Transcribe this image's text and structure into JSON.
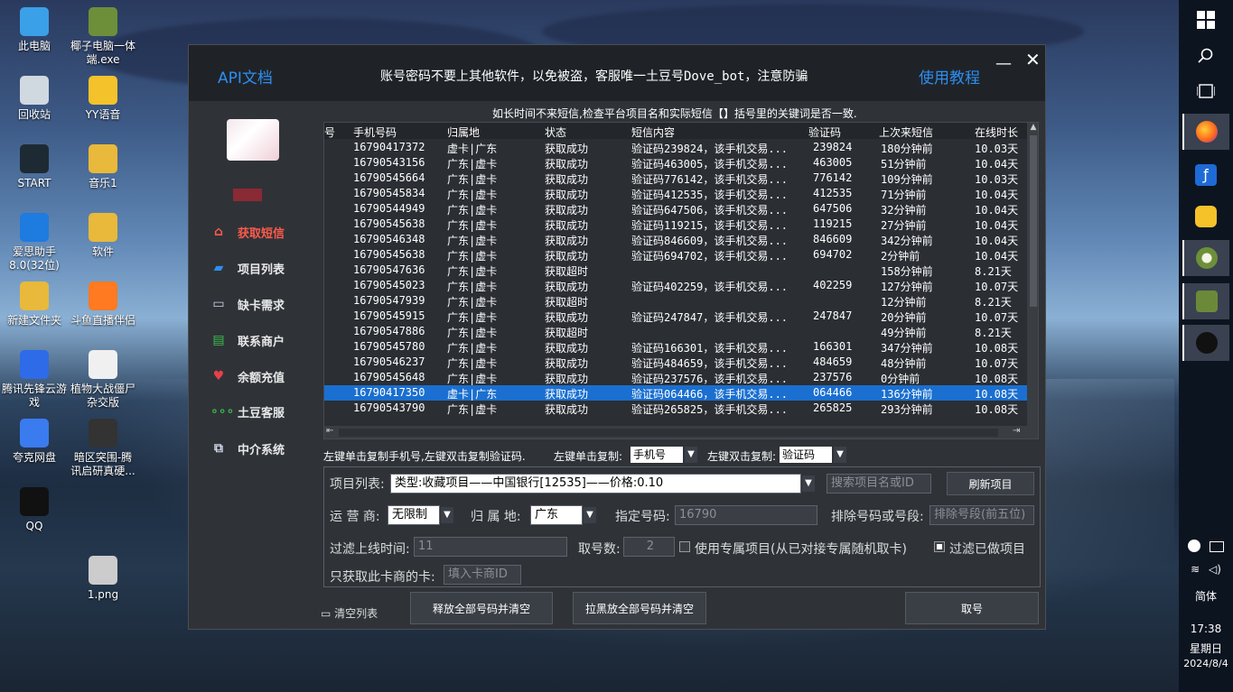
{
  "desktop_icons": [
    {
      "label": "此电脑",
      "icon": "computer-icon",
      "color": "#3aa0e8"
    },
    {
      "label": "椰子电脑一体端.exe",
      "icon": "coconut-icon",
      "color": "#6d8f3a"
    },
    {
      "label": "回收站",
      "icon": "recycle-bin-icon",
      "color": "#d0d8e0"
    },
    {
      "label": "YY语音",
      "icon": "yy-icon",
      "color": "#f4c22b"
    },
    {
      "label": "START",
      "icon": "start-icon",
      "color": "#1e2a33"
    },
    {
      "label": "音乐1",
      "icon": "folder-icon",
      "color": "#e8b93a"
    },
    {
      "label": "爱思助手8.0(32位)",
      "icon": "i4-icon",
      "color": "#1e7be0"
    },
    {
      "label": "软件",
      "icon": "folder-icon",
      "color": "#e8b93a"
    },
    {
      "label": "新建文件夹",
      "icon": "folder-icon",
      "color": "#e8b93a"
    },
    {
      "label": "斗鱼直播伴侣",
      "icon": "douyu-icon",
      "color": "#ff7a20"
    },
    {
      "label": "腾讯先锋云游戏",
      "icon": "cloud-game-icon",
      "color": "#2d6be8"
    },
    {
      "label": "植物大战僵尸杂交版",
      "icon": "file-icon",
      "color": "#f0f0f0"
    },
    {
      "label": "夸克网盘",
      "icon": "quark-icon",
      "color": "#3a7bf0"
    },
    {
      "label": "暗区突围-腾讯启研真硬...",
      "icon": "game-icon",
      "color": "#333333"
    },
    {
      "label": "QQ",
      "icon": "qq-icon",
      "color": "#111111"
    },
    {
      "label": "1.png",
      "icon": "image-icon",
      "color": "#cccccc"
    }
  ],
  "window": {
    "api_doc": "API文档",
    "notice": "账号密码不要上其他软件，以免被盗，客服唯一土豆号Dove_bot，注意防骗",
    "tutorial": "使用教程",
    "minimize": "—",
    "close": "✕"
  },
  "nav": [
    {
      "label": "获取短信",
      "icon": "home-icon",
      "glyph": "⌂",
      "active": true
    },
    {
      "label": "项目列表",
      "icon": "folder-icon",
      "glyph": "▰",
      "active": false
    },
    {
      "label": "缺卡需求",
      "icon": "monitor-icon",
      "glyph": "▭",
      "active": false
    },
    {
      "label": "联系商户",
      "icon": "chat-icon",
      "glyph": "▤",
      "active": false
    },
    {
      "label": "余额充值",
      "icon": "heart-icon",
      "glyph": "♥",
      "active": false
    },
    {
      "label": "土豆客服",
      "icon": "dots-icon",
      "glyph": "∘∘∘",
      "active": false
    },
    {
      "label": "中介系统",
      "icon": "network-icon",
      "glyph": "⧉",
      "active": false
    }
  ],
  "hint_top": "如长时间不来短信,检查平台项目名和实际短信【】括号里的关键词是否一致.",
  "table": {
    "headers": [
      "号",
      "手机号码",
      "归属地",
      "状态",
      "短信内容",
      "验证码",
      "上次来短信",
      "在线时长"
    ],
    "rows": [
      {
        "phone": "16790417372",
        "loc": "虚卡|广东",
        "status": "获取成功",
        "sms": "验证码239824，该手机交易...",
        "code": "239824",
        "last": "180分钟前",
        "online": "10.03天",
        "selected": false
      },
      {
        "phone": "16790543156",
        "loc": "广东|虚卡",
        "status": "获取成功",
        "sms": "验证码463005，该手机交易...",
        "code": "463005",
        "last": "51分钟前",
        "online": "10.04天",
        "selected": false
      },
      {
        "phone": "16790545664",
        "loc": "广东|虚卡",
        "status": "获取成功",
        "sms": "验证码776142，该手机交易...",
        "code": "776142",
        "last": "109分钟前",
        "online": "10.03天",
        "selected": false
      },
      {
        "phone": "16790545834",
        "loc": "广东|虚卡",
        "status": "获取成功",
        "sms": "验证码412535，该手机交易...",
        "code": "412535",
        "last": "71分钟前",
        "online": "10.04天",
        "selected": false
      },
      {
        "phone": "16790544949",
        "loc": "广东|虚卡",
        "status": "获取成功",
        "sms": "验证码647506，该手机交易...",
        "code": "647506",
        "last": "32分钟前",
        "online": "10.04天",
        "selected": false
      },
      {
        "phone": "16790545638",
        "loc": "广东|虚卡",
        "status": "获取成功",
        "sms": "验证码119215，该手机交易...",
        "code": "119215",
        "last": "27分钟前",
        "online": "10.04天",
        "selected": false
      },
      {
        "phone": "16790546348",
        "loc": "广东|虚卡",
        "status": "获取成功",
        "sms": "验证码846609，该手机交易...",
        "code": "846609",
        "last": "342分钟前",
        "online": "10.04天",
        "selected": false
      },
      {
        "phone": "16790545638",
        "loc": "广东|虚卡",
        "status": "获取成功",
        "sms": "验证码694702，该手机交易...",
        "code": "694702",
        "last": "2分钟前",
        "online": "10.04天",
        "selected": false
      },
      {
        "phone": "16790547636",
        "loc": "广东|虚卡",
        "status": "获取超时",
        "sms": "",
        "code": "",
        "last": "158分钟前",
        "online": "8.21天",
        "selected": false
      },
      {
        "phone": "16790545023",
        "loc": "广东|虚卡",
        "status": "获取成功",
        "sms": "验证码402259，该手机交易...",
        "code": "402259",
        "last": "127分钟前",
        "online": "10.07天",
        "selected": false
      },
      {
        "phone": "16790547939",
        "loc": "广东|虚卡",
        "status": "获取超时",
        "sms": "",
        "code": "",
        "last": "12分钟前",
        "online": "8.21天",
        "selected": false
      },
      {
        "phone": "16790545915",
        "loc": "广东|虚卡",
        "status": "获取成功",
        "sms": "验证码247847，该手机交易...",
        "code": "247847",
        "last": "20分钟前",
        "online": "10.07天",
        "selected": false
      },
      {
        "phone": "16790547886",
        "loc": "广东|虚卡",
        "status": "获取超时",
        "sms": "",
        "code": "",
        "last": "49分钟前",
        "online": "8.21天",
        "selected": false
      },
      {
        "phone": "16790545780",
        "loc": "广东|虚卡",
        "status": "获取成功",
        "sms": "验证码166301，该手机交易...",
        "code": "166301",
        "last": "347分钟前",
        "online": "10.08天",
        "selected": false
      },
      {
        "phone": "16790546237",
        "loc": "广东|虚卡",
        "status": "获取成功",
        "sms": "验证码484659，该手机交易...",
        "code": "484659",
        "last": "48分钟前",
        "online": "10.07天",
        "selected": false
      },
      {
        "phone": "16790545648",
        "loc": "广东|虚卡",
        "status": "获取成功",
        "sms": "验证码237576，该手机交易...",
        "code": "237576",
        "last": "0分钟前",
        "online": "10.08天",
        "selected": false
      },
      {
        "phone": "16790417350",
        "loc": "虚卡|广东",
        "status": "获取成功",
        "sms": "验证码064466，该手机交易...",
        "code": "064466",
        "last": "136分钟前",
        "online": "10.08天",
        "selected": true
      },
      {
        "phone": "16790543790",
        "loc": "广东|虚卡",
        "status": "获取成功",
        "sms": "验证码265825，该手机交易...",
        "code": "265825",
        "last": "293分钟前",
        "online": "10.08天",
        "selected": false
      }
    ]
  },
  "copy_hint": "左键单击复制手机号,左键双击复制验证码.",
  "left_click_label": "左键单击复制:",
  "left_click_value": "手机号",
  "left_dbl_label": "左键双击复制:",
  "left_dbl_value": "验证码",
  "form": {
    "project_label": "项目列表:",
    "project_value": "类型:收藏项目——中国银行[12535]——价格:0.10",
    "search_placeholder": "搜索项目名或ID",
    "refresh_button": "刷新项目",
    "carrier_label": "运 营 商:",
    "carrier_value": "无限制",
    "location_label": "归 属 地:",
    "location_value": "广东",
    "number_label": "指定号码:",
    "number_value": "16790",
    "exclude_label": "排除号码或号段:",
    "exclude_placeholder": "排除号段(前五位)",
    "filter_time_label": "过滤上线时间:",
    "filter_time_value": "11",
    "count_label": "取号数:",
    "count_value": "2",
    "exclusive_label": "使用专属项目(从已对接专属随机取卡)",
    "filter_done_label": "过滤已做项目",
    "only_card_label": "只获取此卡商的卡:",
    "card_placeholder": "填入卡商ID"
  },
  "buttons": {
    "list_label": "清空列表",
    "release_all": "释放全部号码并清空",
    "blacklist_all": "拉黑放全部号码并清空",
    "get_number": "取号"
  },
  "tray": {
    "ime": "简体",
    "time": "17:38",
    "weekday": "星期日",
    "date": "2024/8/4"
  }
}
